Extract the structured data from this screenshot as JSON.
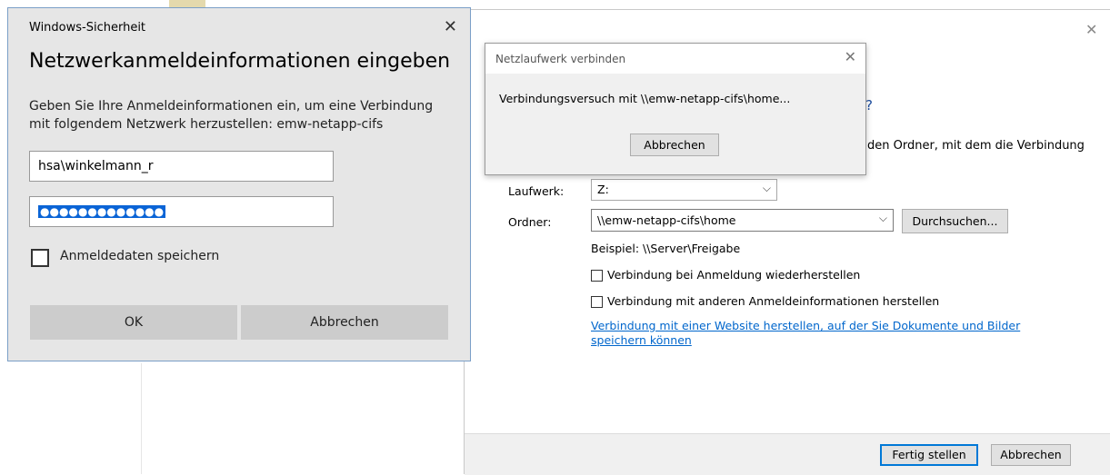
{
  "security_dialog": {
    "title": "Windows-Sicherheit",
    "close": "✕",
    "heading": "Netzwerkanmeldeinformationen eingeben",
    "description": "Geben Sie Ihre Anmeldeinformationen ein, um eine Verbindung mit folgendem Netzwerk herzustellen: emw-netapp-cifs",
    "username_value": "hsa\\winkelmann_r",
    "password_mask": "●●●●●●●●●●●●●",
    "remember_label": "Anmeldedaten speichern",
    "ok_label": "OK",
    "cancel_label": "Abbrechen"
  },
  "map_drive_dialog": {
    "close": "✕",
    "question_fragment": "?",
    "intro_fragment": "den Ordner, mit dem die Verbindung",
    "drive_label": "Laufwerk:",
    "drive_value": "Z:",
    "folder_label": "Ordner:",
    "folder_value": "\\\\emw-netapp-cifs\\home",
    "browse_label": "Durchsuchen...",
    "example": "Beispiel: \\\\Server\\Freigabe",
    "reconnect_label": "Verbindung bei Anmeldung wiederherstellen",
    "other_credentials_label": "Verbindung mit anderen Anmeldeinformationen herstellen",
    "website_link": "Verbindung mit einer Website herstellen, auf der Sie Dokumente und Bilder speichern können",
    "finish_label": "Fertig stellen",
    "cancel_label": "Abbrechen"
  },
  "progress_dialog": {
    "title": "Netzlaufwerk verbinden",
    "close": "✕",
    "message": "Verbindungsversuch mit \\\\emw-netapp-cifs\\home...",
    "cancel_label": "Abbrechen"
  }
}
